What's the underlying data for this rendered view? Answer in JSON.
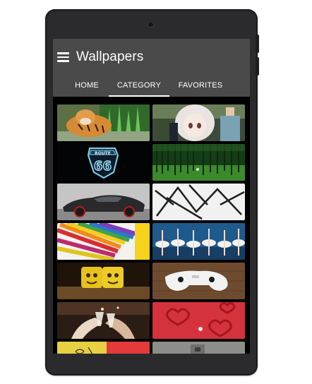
{
  "app": {
    "title": "Wallpapers"
  },
  "tabs": [
    {
      "label": "HOME",
      "active": false
    },
    {
      "label": "CATEGORY",
      "active": true
    },
    {
      "label": "FAVORITES",
      "active": false
    }
  ],
  "icons": {
    "menu": "hamburger-menu-icon"
  },
  "colors": {
    "appbar": "#4a4a4a",
    "screen": "#000000",
    "indicator": "#ffffff"
  },
  "wallpapers": [
    {
      "subject": "tiger"
    },
    {
      "subject": "anime-girl"
    },
    {
      "subject": "route-66",
      "text": "ROUTE 66"
    },
    {
      "subject": "forest"
    },
    {
      "subject": "sports-car"
    },
    {
      "subject": "abstract-sticks"
    },
    {
      "subject": "colored-pencils"
    },
    {
      "subject": "ballet-dancers"
    },
    {
      "subject": "emoji-faces"
    },
    {
      "subject": "game-controller"
    },
    {
      "subject": "champagne-toast"
    },
    {
      "subject": "red-hearts"
    },
    {
      "subject": "drawing-yellow"
    },
    {
      "subject": "wall-gray"
    }
  ]
}
